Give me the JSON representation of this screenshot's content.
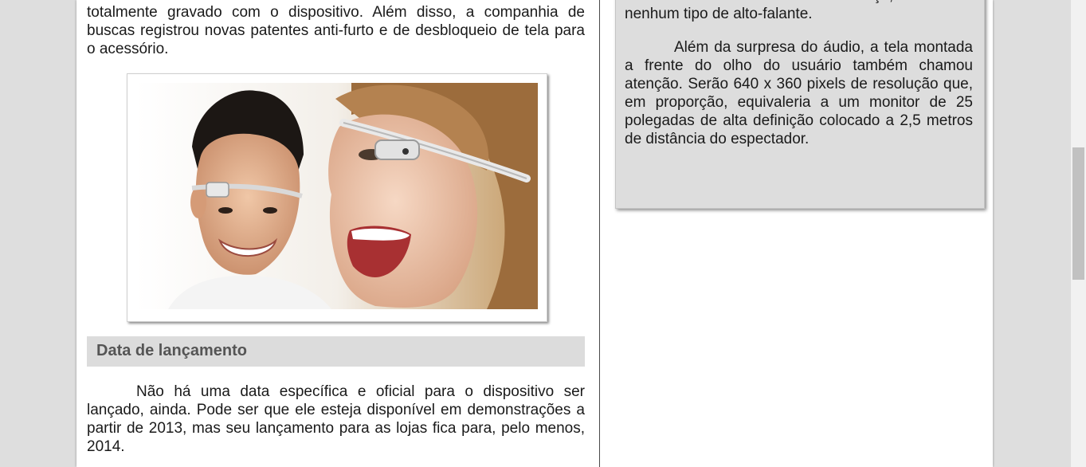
{
  "left_column": {
    "intro_paragraph": "totalmente gravado com o dispositivo. Além disso, a companhia de buscas registrou novas patentes anti-furto e de desbloqueio de tela para o acessório.",
    "section_title": "Data de lançamento",
    "launch_paragraph": "Não há uma data específica e oficial para o dispositivo ser lançado, ainda. Pode ser que ele esteja disponível em demonstrações a partir de 2013, mas seu lançamento para as lojas fica para, pelo menos, 2014."
  },
  "sidebar": {
    "paragraph_1": "determinados ossos de sua cabeça, sem usar nenhum tipo de alto-falante.",
    "paragraph_2": "Além da surpresa do áudio, a tela montada a frente do olho do usuário também chamou atenção. Serão 640 x 360 pixels de resolução que, em proporção, equivaleria a um monitor de 25 polegadas de alta definição colocado a 2,5 metros de distância do espectador."
  },
  "colors": {
    "page_background": "#dedede",
    "sheet": "#ffffff",
    "section_band": "#dcdcdc",
    "section_title_text": "#555555",
    "sidebar_background": "#dddddd"
  }
}
